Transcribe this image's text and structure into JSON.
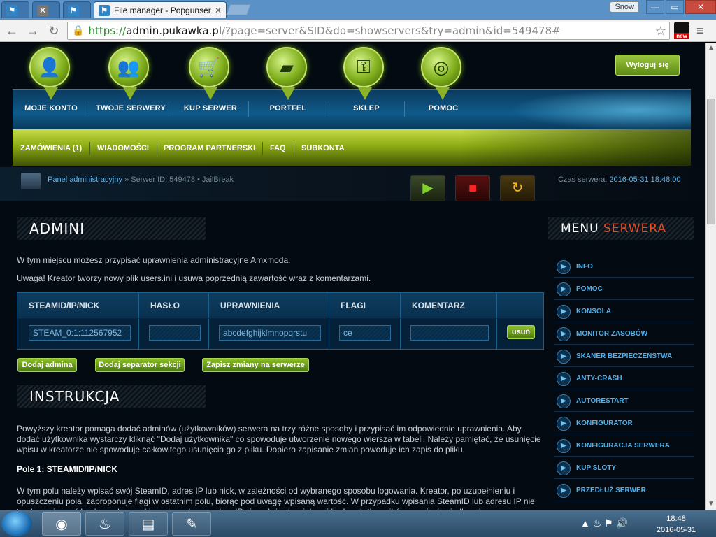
{
  "browser": {
    "tabs": [
      {
        "label": "",
        "icon": "app-icon"
      },
      {
        "label": "",
        "icon": "x-icon"
      },
      {
        "label": "",
        "icon": "app-icon"
      },
      {
        "label": "File manager - Popgunser",
        "icon": "app-icon"
      }
    ],
    "profile": "Snow",
    "url_scheme": "https://",
    "url_host": "admin.pukawka.pl",
    "url_path": "/?page=server&SID&do=showservers&try=admin&id=549478#",
    "ext_badge": "new"
  },
  "topnav": {
    "items": [
      {
        "label": "MOJE KONTO",
        "icon": "user-icon"
      },
      {
        "label": "TWOJE SERWERY",
        "icon": "players-icon"
      },
      {
        "label": "KUP SERWER",
        "icon": "cart-icon"
      },
      {
        "label": "PORTFEL",
        "icon": "gold-icon"
      },
      {
        "label": "SKLEP",
        "icon": "key-icon"
      },
      {
        "label": "POMOC",
        "icon": "lifebuoy-icon"
      }
    ],
    "logout": "Wyloguj się"
  },
  "subnav": {
    "items": [
      "ZAMÓWIENIA (1)",
      "WIADOMOŚCI",
      "PROGRAM PARTNERSKI",
      "FAQ",
      "SUBKONTA"
    ]
  },
  "breadcrumb": {
    "link": "Panel administracyjny",
    "rest": " » Serwer ID: 549478 • JailBreak",
    "server_time_label": "Czas serwera: ",
    "server_time": "2016-05-31 18:48:00"
  },
  "main": {
    "admins_title": "ADMINI",
    "intro": "W tym miejscu możesz przypisać uprawnienia administracyjne Amxmoda.",
    "warning": "Uwaga! Kreator tworzy nowy plik users.ini i usuwa poprzednią zawartość wraz z komentarzami.",
    "table": {
      "headers": [
        "STEAMID/IP/NICK",
        "HASŁO",
        "UPRAWNIENIA",
        "FLAGI",
        "KOMENTARZ"
      ],
      "row": {
        "steamid": "STEAM_0:1:112567952",
        "password": "",
        "rights": "abcdefghijklmnopqrstu",
        "flags": "ce",
        "comment": "",
        "remove": "usuń"
      }
    },
    "buttons": {
      "add_admin": "Dodaj admina",
      "add_separator": "Dodaj separator sekcji",
      "save": "Zapisz zmiany na serwerze"
    },
    "instructions_title": "INSTRUKCJA",
    "instructions_p1": "Powyższy kreator pomaga dodać adminów (użytkowników) serwera na trzy różne sposoby i przypisać im odpowiednie uprawnienia. Aby dodać użytkownika wystarczy kliknąć \"Dodaj użytkownika\" co spowoduje utworzenie nowego wiersza w tabeli. Należy pamiętać, że usunięcie wpisu w kreatorze nie spowoduje całkowitego usunięcia go z pliku. Dopiero zapisanie zmian powoduje ich zapis do pliku.",
    "field1_title": "Pole 1: STEAMID/IP/NICK",
    "field1_text": "W tym polu należy wpisać swój SteamID, adres IP lub nick, w zależności od wybranego sposobu logowania. Kreator, po uzupełnieniu i opuszczeniu pola, zaproponuje flagi w ostatnim polu, biorąc pod uwagę wpisaną wartość. W przypadku wpisania SteamID lub adresu IP nie trzeba wpisywać hasła, pod warunkiem, że wybrany adres IP nie należy do większej liczby użytkowników np. sieci osiedlowej."
  },
  "sidebar": {
    "title_white": "MENU",
    "title_red": "SERWERA",
    "items": [
      "INFO",
      "POMOC",
      "KONSOLA",
      "MONITOR ZASOBÓW",
      "SKANER BEZPIECZEŃSTWA",
      "ANTY-CRASH",
      "AUTORESTART",
      "KONFIGURATOR",
      "KONFIGURACJA SERWERA",
      "KUP SLOTY",
      "PRZEDŁUŻ SERWER"
    ]
  },
  "taskbar": {
    "time": "18:48",
    "date": "2016-05-31",
    "apps": [
      "chrome",
      "steam",
      "explorer",
      "paint"
    ]
  }
}
